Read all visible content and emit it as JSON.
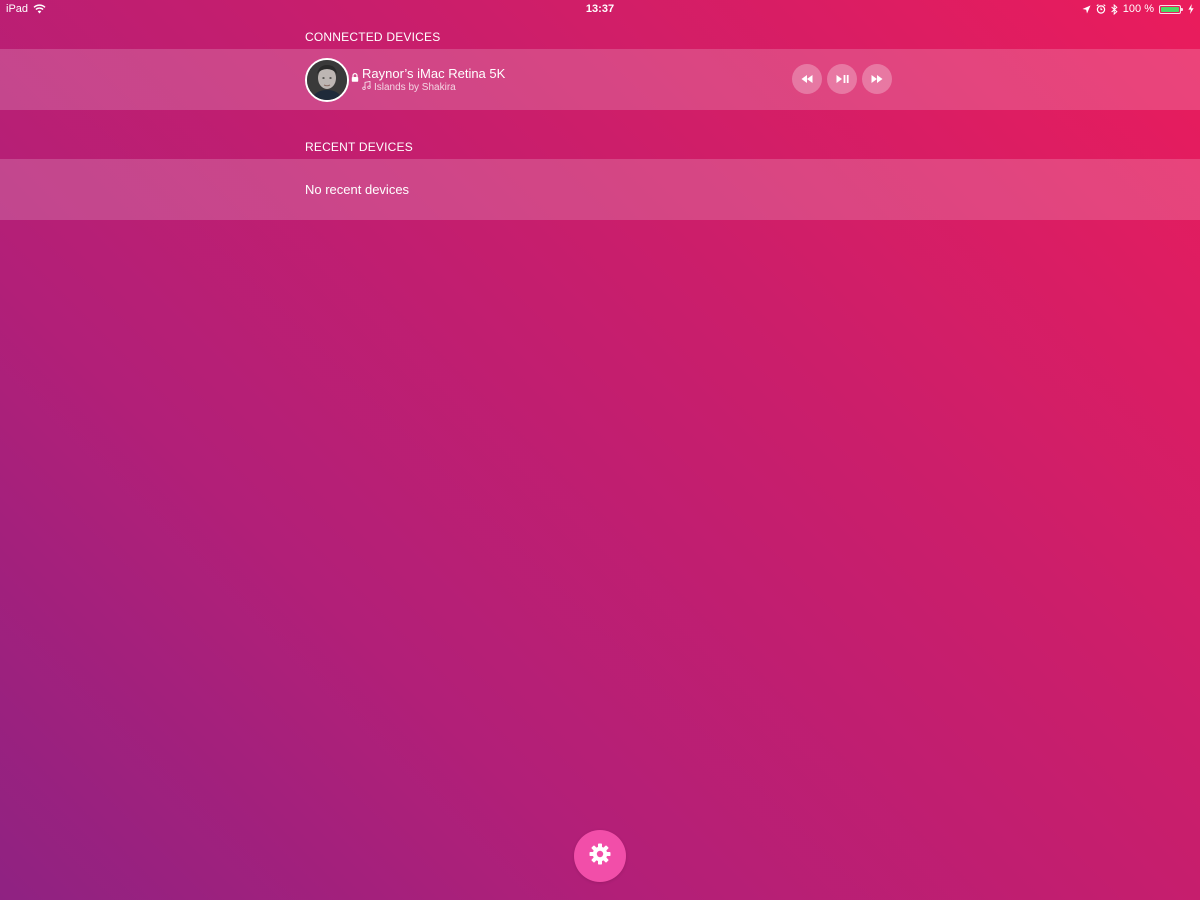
{
  "status_bar": {
    "device": "iPad",
    "time": "13:37",
    "battery_text": "100 %",
    "battery_level": 1.0,
    "battery_color": "#4cd964",
    "icons": [
      "wifi-icon",
      "location-arrow-icon",
      "alarm-icon",
      "bluetooth-icon",
      "battery-icon",
      "charging-icon"
    ]
  },
  "connected": {
    "header": "CONNECTED DEVICES",
    "device": {
      "name": "Raynor’s iMac Retina 5K",
      "now_playing": "Islands by Shakira",
      "icons": [
        "avatar",
        "lock-icon",
        "music-note-icon"
      ]
    },
    "controls": [
      {
        "name": "rewind-button",
        "icon": "rewind-icon"
      },
      {
        "name": "play-pause-button",
        "icon": "play-pause-icon"
      },
      {
        "name": "fast-forward-button",
        "icon": "fast-forward-icon"
      }
    ]
  },
  "recent": {
    "header": "RECENT DEVICES",
    "empty_text": "No recent devices"
  },
  "settings": {
    "icon": "gear-icon",
    "color": "#f24ea9"
  },
  "theme": {
    "gradient": [
      "#8f2282",
      "#b21f78",
      "#cc1e6a",
      "#ea1c5c"
    ]
  }
}
